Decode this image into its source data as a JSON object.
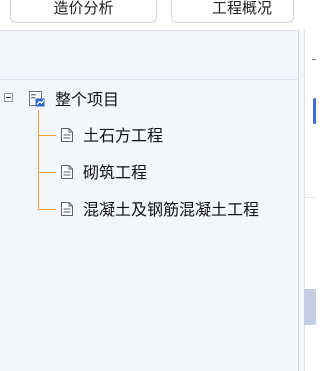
{
  "tabs": [
    "造价分析",
    "工程概况"
  ],
  "tree": {
    "root_label": "整个项目",
    "root_icon": "project-icon",
    "child_icon": "document-icon",
    "children": [
      "土石方工程",
      "砌筑工程",
      "混凝土及钢筋混凝土工程"
    ]
  },
  "colors": {
    "tree_line": "#f0a030",
    "panel_bg": "#f3f6fb",
    "selection_blue": "#3d6fd1"
  }
}
